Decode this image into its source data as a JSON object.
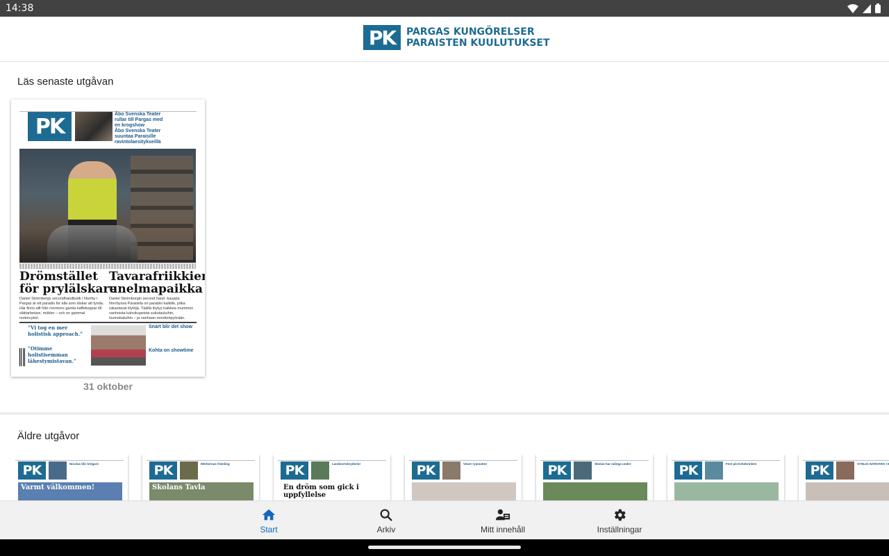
{
  "status_bar": {
    "time": "14:38"
  },
  "app": {
    "logo_letters": "PK",
    "logo_line1": "PARGAS KUNGÖRELSER",
    "logo_line2": "PARAISTEN KUULUTUKSET"
  },
  "latest": {
    "section_title": "Läs senaste utgåvan",
    "date": "31 oktober",
    "cover": {
      "logo_letters": "PK",
      "teaser1_line1": "Åbo Svenska Teater",
      "teaser1_line2": "rullar till Pargas med",
      "teaser1_line3": "en krogshow",
      "teaser2_line1": "Åbo Svenska Teater",
      "teaser2_line2": "suuntaa Paraisille",
      "teaser2_line3": "ravintolaesitykseillä",
      "headline_sv_line1": "Drömstället",
      "headline_sv_line2": "för prylälskare",
      "headline_fi_line1": "Tavarafriikkien",
      "headline_fi_line2": "unelmapaikka",
      "body_sv": "Daniel Strömbergs secondhandbutik i Norrby i Pargas är ett paradis för alla som älskar att fynda. Här finns allt från mormors gamla kaffekoppar till slättarbetare, möbler – och en gammal motorcykel.",
      "body_fi": "Daniel Strömborgin second hand -kauppa Norrbyssä Paraisilla on paratiisi kaikille, jotka rakastavat löytöjä. Täältä löytyy kaikkea mummon vanhoista kahvikupeista sukutauluihin, huonekaluihin – ja vanhaan moottoripyörään.",
      "quote1": "”Vi tog en mer holistisk approach.”",
      "quote2": "”Otimme holistisemman lähestymistavan.”",
      "side1": "Snart blir det show",
      "side2": "Kohta on showtime"
    }
  },
  "older": {
    "section_title": "Äldre utgåvor",
    "issues": [
      {
        "logo_letters": "PK",
        "teaser": "Nicolas blir krögare",
        "banner": "Varmt välkommen!",
        "img_color": "#4a6a8a",
        "big_color": "#5a7fb0"
      },
      {
        "logo_letters": "PK",
        "teaser": "Mörkernas främling",
        "banner": "Skolans Tavla",
        "img_color": "#6b6b4a",
        "big_color": "#7a8a6a"
      },
      {
        "logo_letters": "PK",
        "teaser": "Landsortsbryderier",
        "banner": "En dröm som gick i uppfyllelse",
        "img_color": "#5a7a5a",
        "big_color": "#ffffff"
      },
      {
        "logo_letters": "PK",
        "teaser": "Väver ryamattor",
        "banner": "",
        "img_color": "#8a7a6a",
        "big_color": "#d0c8c0"
      },
      {
        "logo_letters": "PK",
        "teaser": "Skolan har många under",
        "banner": "",
        "img_color": "#4a6a7a",
        "big_color": "#6a8a5a"
      },
      {
        "logo_letters": "PK",
        "teaser": "Fest på Kirkebrinken",
        "banner": "",
        "img_color": "#5a8aa0",
        "big_color": "#9ab8a0"
      },
      {
        "logo_letters": "PK",
        "teaser": "SYNLIG NÄRVARO I ETT NÄTVERK",
        "banner": "",
        "img_color": "#8a6a5a",
        "big_color": "#c8c0b8"
      }
    ]
  },
  "bottom_nav": {
    "start": "Start",
    "archive": "Arkiv",
    "my_content": "Mitt innehåll",
    "settings": "Inställningar",
    "active_color": "#1565c0"
  }
}
